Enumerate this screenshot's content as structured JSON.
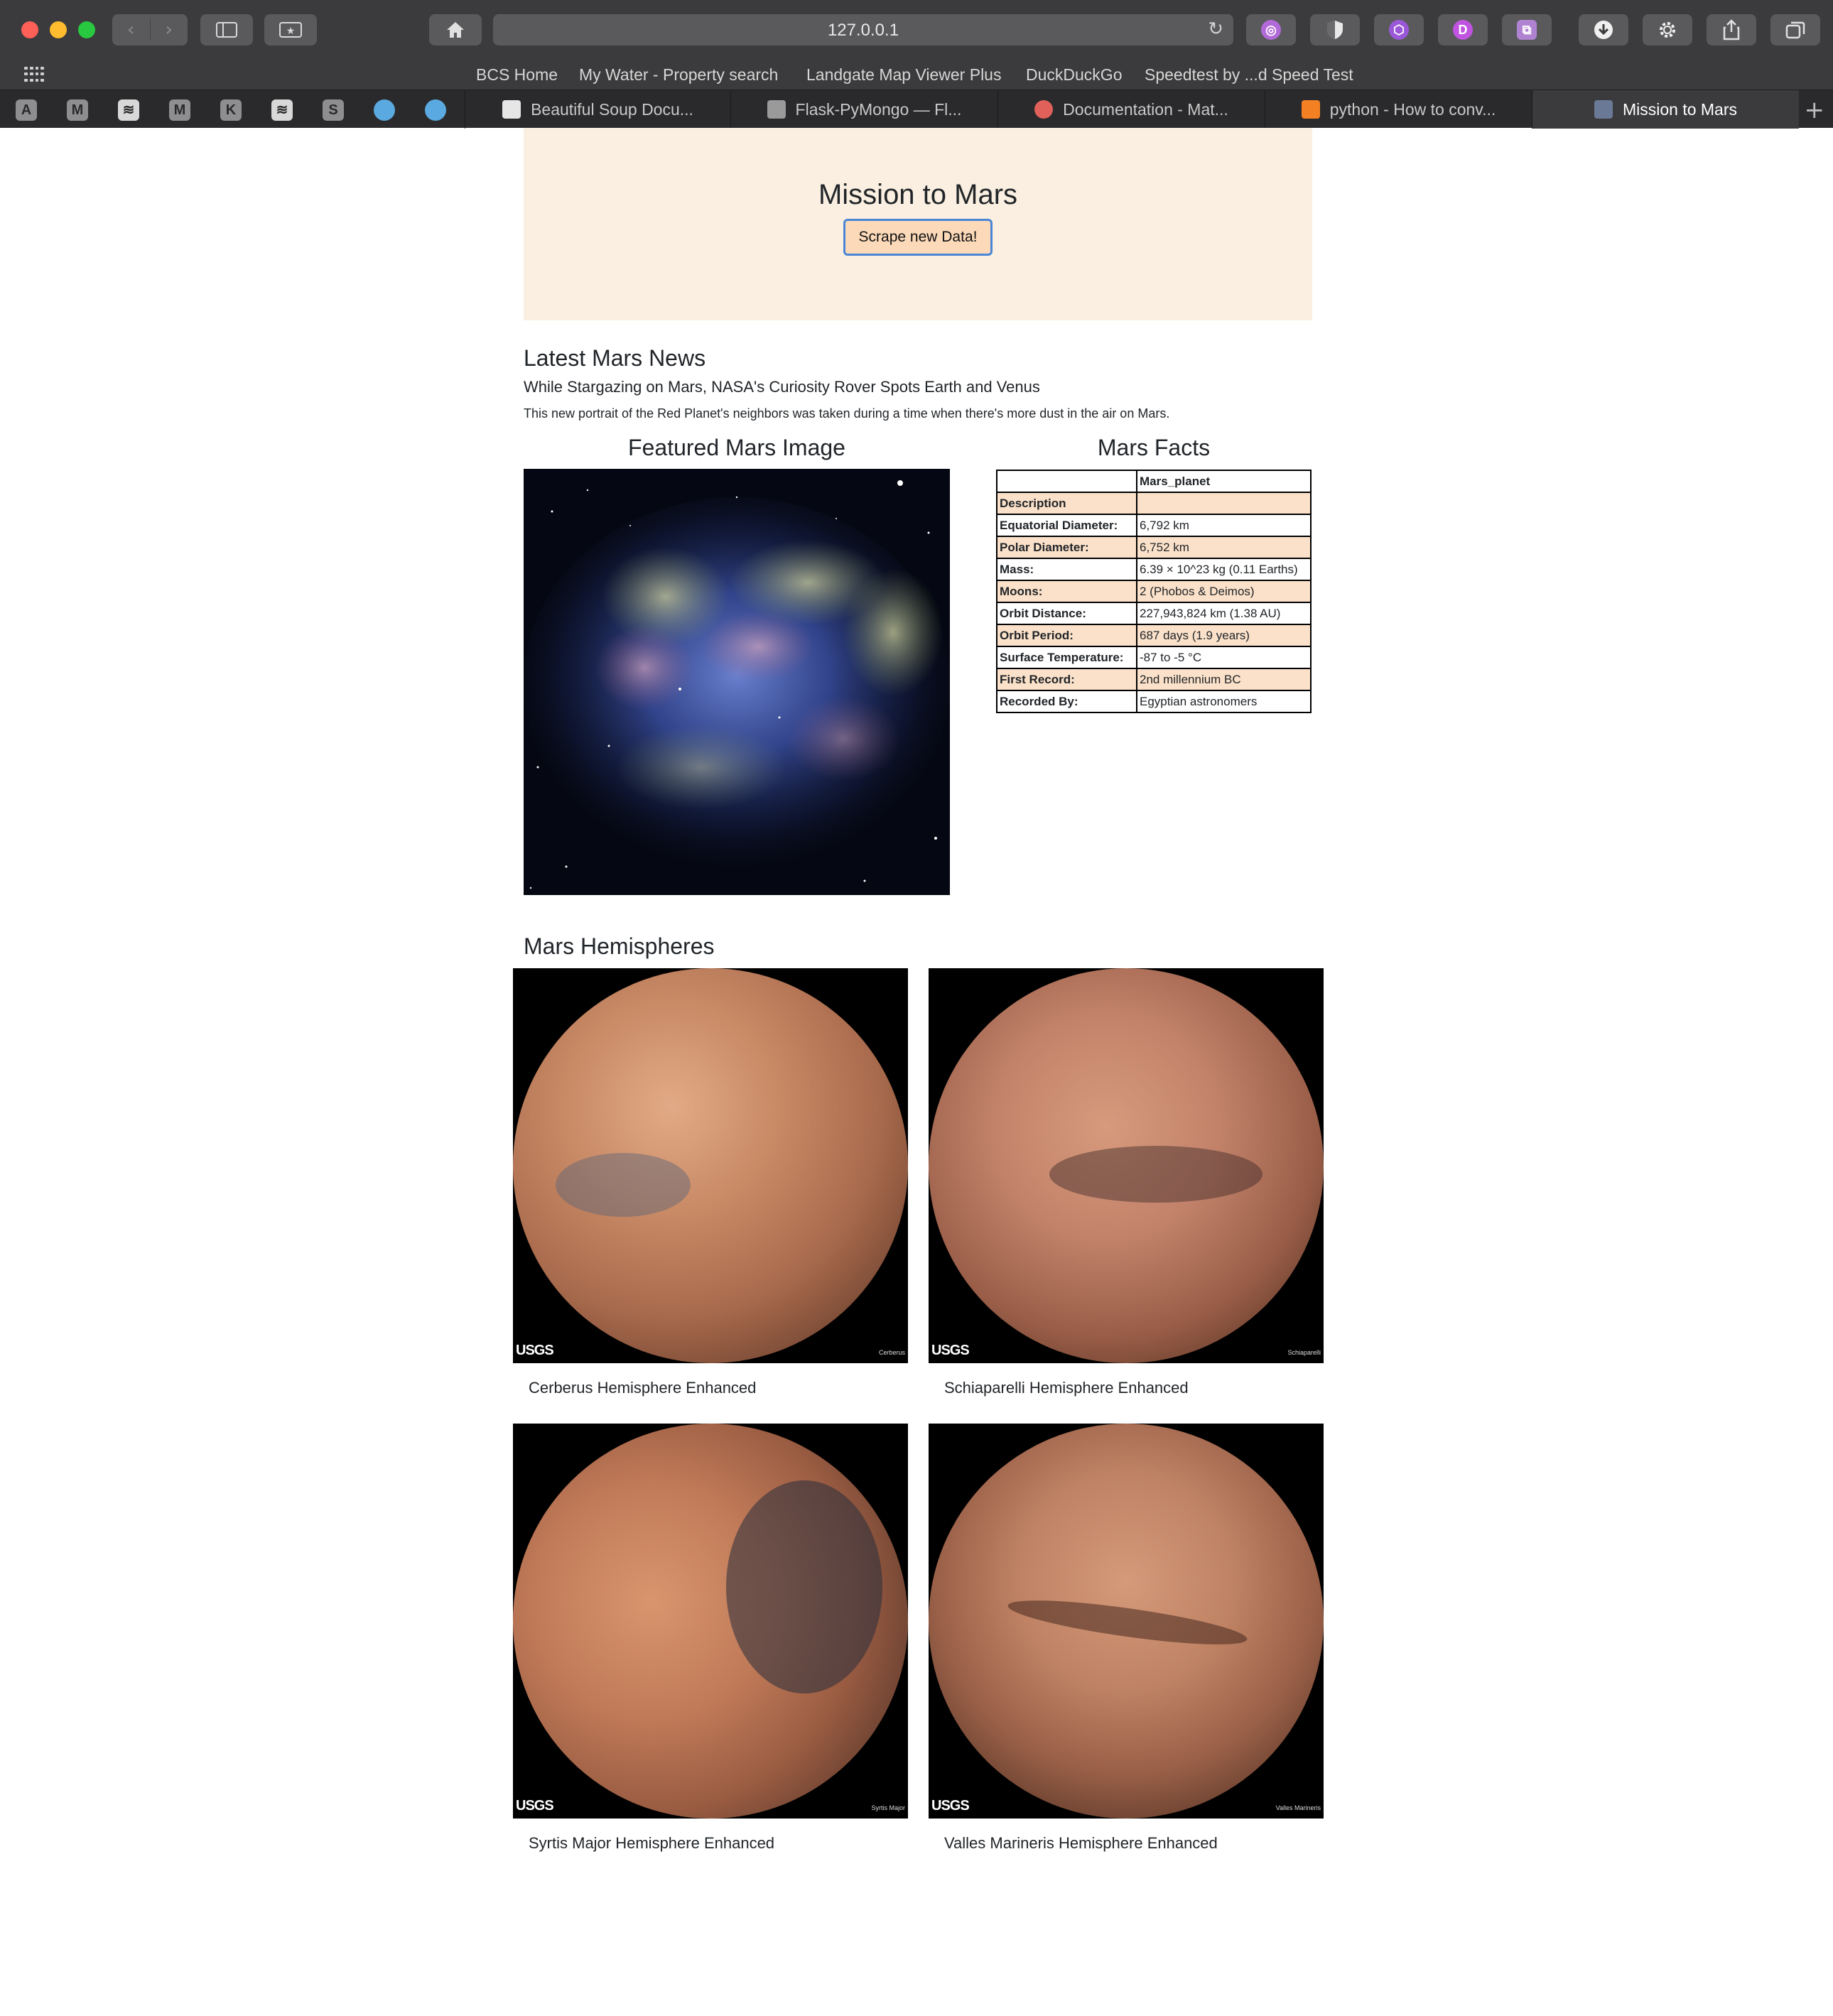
{
  "browser": {
    "url": "127.0.0.1",
    "bookmarks": [
      "BCS Home",
      "My Water - Property search",
      "Landgate Map Viewer Plus",
      "DuckDuckGo",
      "Speedtest by ...d Speed Test"
    ],
    "pinned_tabs": [
      "A",
      "M",
      "",
      "M",
      "K",
      "",
      "S",
      "",
      ""
    ],
    "tabs": [
      {
        "label": "Beautiful Soup Docu...",
        "color": "#6b8fd6"
      },
      {
        "label": "Flask-PyMongo — Fl...",
        "color": "#8a8a8a"
      },
      {
        "label": "Documentation - Mat...",
        "color": "#e0605a"
      },
      {
        "label": "python - How to conv...",
        "color": "#f48024"
      },
      {
        "label": "Mission to Mars",
        "color": "#6a7a96"
      }
    ],
    "extension_colors": [
      "#b26ad9",
      "#e8e8e8",
      "#9a58d8",
      "#c054e0",
      "#b083d2"
    ]
  },
  "jumbotron": {
    "title": "Mission to Mars",
    "button_label": "Scrape new Data!"
  },
  "news": {
    "heading": "Latest Mars News",
    "title": "While Stargazing on Mars, NASA's Curiosity Rover Spots Earth and Venus",
    "paragraph": "This new portrait of the Red Planet's neighbors was taken during a time when there's more dust in the air on Mars."
  },
  "featured": {
    "heading": "Featured Mars Image"
  },
  "facts": {
    "heading": "Mars Facts",
    "column_header": "Mars_planet",
    "rows": [
      {
        "label": "Description",
        "value": ""
      },
      {
        "label": "Equatorial Diameter:",
        "value": "6,792 km"
      },
      {
        "label": "Polar Diameter:",
        "value": "6,752 km"
      },
      {
        "label": "Mass:",
        "value": "6.39 × 10^23 kg (0.11 Earths)"
      },
      {
        "label": "Moons:",
        "value": "2 (Phobos & Deimos)"
      },
      {
        "label": "Orbit Distance:",
        "value": "227,943,824 km (1.38 AU)"
      },
      {
        "label": "Orbit Period:",
        "value": "687 days (1.9 years)"
      },
      {
        "label": "Surface Temperature:",
        "value": "-87 to -5 °C"
      },
      {
        "label": "First Record:",
        "value": "2nd millennium BC"
      },
      {
        "label": "Recorded By:",
        "value": "Egyptian astronomers"
      }
    ]
  },
  "hemispheres": {
    "heading": "Mars Hemispheres",
    "items": [
      {
        "title": "Cerberus Hemisphere Enhanced",
        "image_tag": "Cerberus"
      },
      {
        "title": "Schiaparelli Hemisphere Enhanced",
        "image_tag": "Schiaparelli"
      },
      {
        "title": "Syrtis Major Hemisphere Enhanced",
        "image_tag": "Syrtis Major"
      },
      {
        "title": "Valles Marineris Hemisphere Enhanced",
        "image_tag": "Valles Marineris"
      }
    ],
    "logo_text": "USGS"
  }
}
